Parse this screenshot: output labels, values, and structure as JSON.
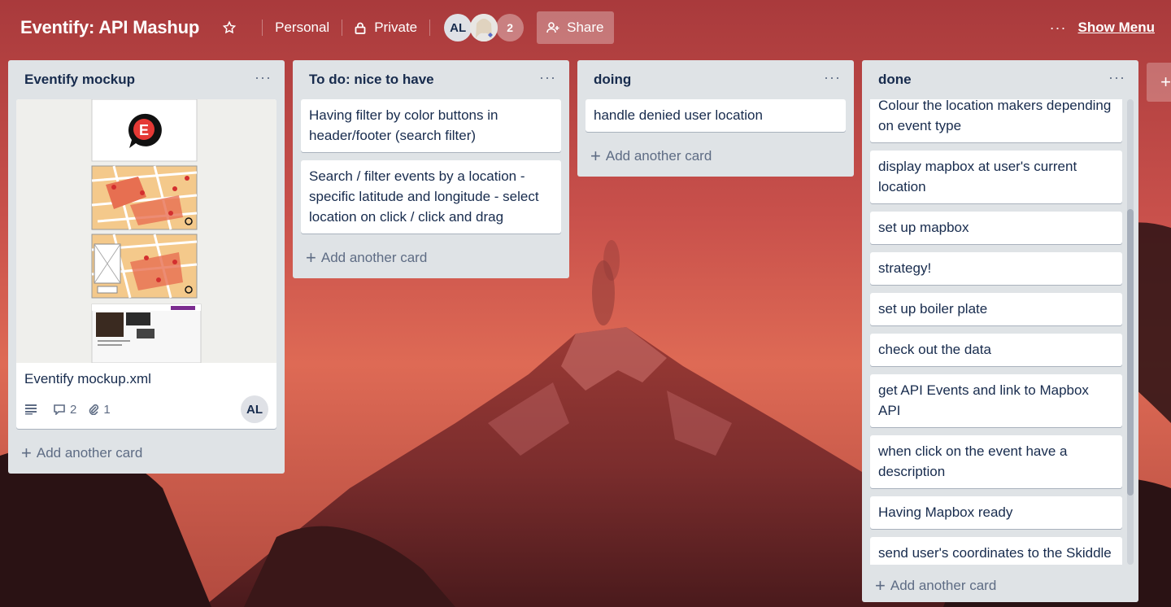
{
  "header": {
    "board_title": "Eventify: API Mashup",
    "team": "Personal",
    "visibility": "Private",
    "member_initials": "AL",
    "member_count": "2",
    "share_label": "Share",
    "more_glyph": "···",
    "show_menu_label": "Show Menu"
  },
  "icons": {
    "star": "star-icon",
    "lock": "lock-icon",
    "share": "add-person-icon",
    "more": "ellipsis-icon",
    "plus": "plus-icon",
    "description": "description-icon",
    "comment": "comment-icon",
    "attachment": "paperclip-icon"
  },
  "lists": [
    {
      "title": "Eventify mockup",
      "cards": [
        {
          "title": "Eventify mockup.xml",
          "comments": "2",
          "attachments": "1",
          "member": "AL"
        }
      ],
      "add_label": "Add another card"
    },
    {
      "title": "To do: nice to have",
      "cards": [
        {
          "title": "Having filter by color buttons in header/footer (search filter)"
        },
        {
          "title": "Search / filter events by a location - specific latitude and longitude - select location on click / click and drag"
        }
      ],
      "add_label": "Add another card"
    },
    {
      "title": "doing",
      "cards": [
        {
          "title": "handle denied user location"
        }
      ],
      "add_label": "Add another card"
    },
    {
      "title": "done",
      "cards": [
        {
          "title": "Colour the location makers depending on event type"
        },
        {
          "title": "display mapbox at user's current location"
        },
        {
          "title": "set up mapbox"
        },
        {
          "title": "strategy!"
        },
        {
          "title": "set up boiler plate"
        },
        {
          "title": "check out the data"
        },
        {
          "title": "get API Events and link to Mapbox API"
        },
        {
          "title": "when click on the event have a description"
        },
        {
          "title": "Having Mapbox ready"
        },
        {
          "title": "send user's coordinates to the Skiddle API"
        }
      ],
      "add_label": "Add another card"
    }
  ],
  "add_list_glyph": "+",
  "list_menu_glyph": "···",
  "colors": {
    "list_bg": "#dfe3e6",
    "text": "#172b4d",
    "muted": "#5e6c84",
    "sky": "#c9574e"
  }
}
